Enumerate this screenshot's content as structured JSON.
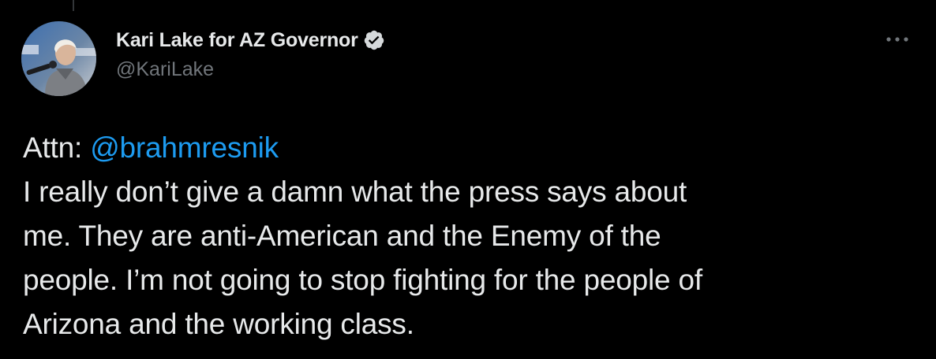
{
  "author": {
    "display_name": "Kari Lake for AZ Governor",
    "handle": "@KariLake",
    "verified": true
  },
  "tweet": {
    "prefix": "Attn: ",
    "mention": "@brahmresnik",
    "lines": [
      "I really don’t give a damn what the press says about",
      "me. They are anti-American and the Enemy of the",
      "people. I’m not going to stop fighting for the people of",
      "Arizona and the working class."
    ]
  },
  "icons": {
    "avatar": "profile-photo",
    "verified": "verified-badge-icon",
    "more": "more-options-icon"
  },
  "colors": {
    "background": "#000000",
    "text": "#e7e9ea",
    "secondary_text": "#71767b",
    "link": "#1d9bf0"
  }
}
